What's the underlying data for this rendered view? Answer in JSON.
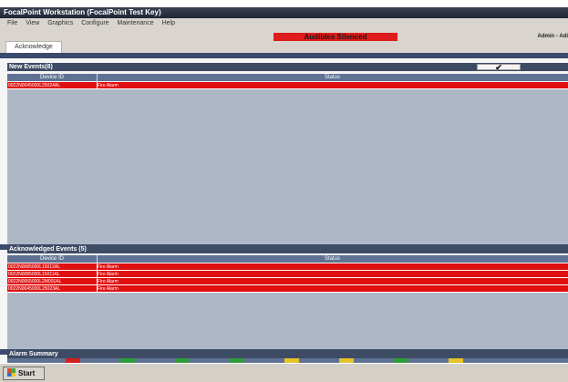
{
  "window": {
    "title": "FocalPoint Workstation (FocalPoint Test Key)",
    "user": "Admin - Adi"
  },
  "menu": [
    "File",
    "View",
    "Graphics",
    "Configure",
    "Maintenance",
    "Help"
  ],
  "alarm_banner": "Audibles Silenced",
  "tab": {
    "label": "Acknowledge"
  },
  "new_events": {
    "header": "New Events(8)",
    "ack_button_glyph": "✔",
    "columns": [
      "Device ID",
      "Status"
    ],
    "rows": [
      {
        "device_id": "0022N0045000L25024AL",
        "status": "Fire Alarm"
      }
    ]
  },
  "acknowledged_events": {
    "header": "Acknowledged Events (5)",
    "columns": [
      "Device ID",
      "Status"
    ],
    "rows": [
      {
        "device_id": "0022N0085000L15012AL",
        "status": "Fire Alarm"
      },
      {
        "device_id": "0022N0085000L15011AL",
        "status": "Fire Alarm"
      },
      {
        "device_id": "0022N0065000L2M001AL",
        "status": "Fire Alarm"
      },
      {
        "device_id": "0022N0045000L25023AL",
        "status": "Fire Alarm"
      }
    ]
  },
  "alarm_summary": {
    "header": "Alarm Summary"
  },
  "taskbar": {
    "start_label": "Start"
  },
  "colors": {
    "alarm_red": "#e01010",
    "header_navy": "#3e4b65",
    "grid_gray": "#aeb7c6",
    "summary_indicators": [
      "#d32020",
      "#2f9a3a",
      "#2f9a3a",
      "#2f9a3a",
      "#e6c229",
      "#e6c229",
      "#2f9a3a",
      "#e6c229"
    ]
  }
}
